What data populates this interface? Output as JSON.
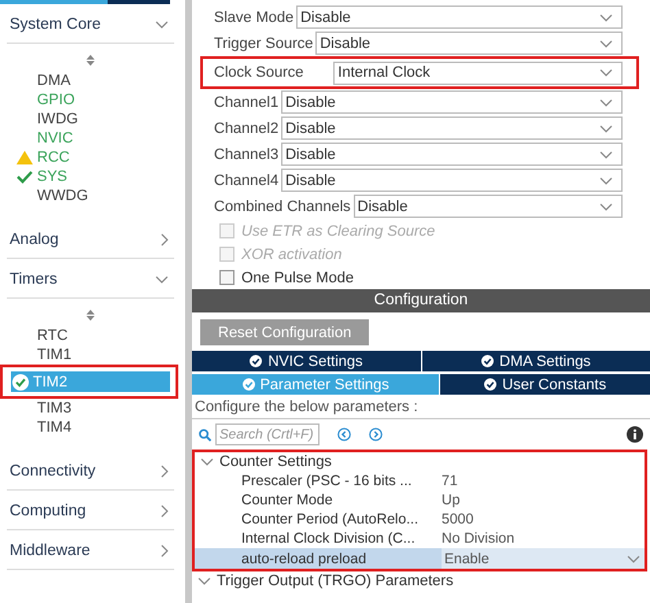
{
  "sidebar": {
    "sections": [
      {
        "title": "System Core",
        "expanded": true,
        "items": [
          {
            "label": "DMA",
            "active": false,
            "warning": false,
            "ok": false,
            "selected": false,
            "highlighted": false
          },
          {
            "label": "GPIO",
            "active": true,
            "warning": false,
            "ok": false,
            "selected": false,
            "highlighted": false
          },
          {
            "label": "IWDG",
            "active": false,
            "warning": false,
            "ok": false,
            "selected": false,
            "highlighted": false
          },
          {
            "label": "NVIC",
            "active": true,
            "warning": false,
            "ok": false,
            "selected": false,
            "highlighted": false
          },
          {
            "label": "RCC",
            "active": true,
            "warning": true,
            "ok": false,
            "selected": false,
            "highlighted": false
          },
          {
            "label": "SYS",
            "active": true,
            "warning": false,
            "ok": true,
            "selected": false,
            "highlighted": false
          },
          {
            "label": "WWDG",
            "active": false,
            "warning": false,
            "ok": false,
            "selected": false,
            "highlighted": false
          }
        ]
      },
      {
        "title": "Analog",
        "expanded": false
      },
      {
        "title": "Timers",
        "expanded": true,
        "items": [
          {
            "label": "RTC",
            "active": false,
            "warning": false,
            "ok": false,
            "selected": false,
            "highlighted": false
          },
          {
            "label": "TIM1",
            "active": false,
            "warning": false,
            "ok": false,
            "selected": false,
            "highlighted": false
          },
          {
            "label": "TIM2",
            "active": false,
            "warning": false,
            "ok": true,
            "selected": true,
            "highlighted": true
          },
          {
            "label": "TIM3",
            "active": false,
            "warning": false,
            "ok": false,
            "selected": false,
            "highlighted": false
          },
          {
            "label": "TIM4",
            "active": false,
            "warning": false,
            "ok": false,
            "selected": false,
            "highlighted": false
          }
        ]
      },
      {
        "title": "Connectivity",
        "expanded": false
      },
      {
        "title": "Computing",
        "expanded": false
      },
      {
        "title": "Middleware",
        "expanded": false
      }
    ]
  },
  "mode": {
    "fields": [
      {
        "label": "Slave Mode",
        "value": "Disable",
        "highlighted": false
      },
      {
        "label": "Trigger Source",
        "value": "Disable",
        "highlighted": false
      },
      {
        "label": "Clock Source",
        "value": "Internal Clock",
        "highlighted": true
      },
      {
        "label": "Channel1",
        "value": "Disable",
        "highlighted": false
      },
      {
        "label": "Channel2",
        "value": "Disable",
        "highlighted": false
      },
      {
        "label": "Channel3",
        "value": "Disable",
        "highlighted": false
      },
      {
        "label": "Channel4",
        "value": "Disable",
        "highlighted": false
      },
      {
        "label": "Combined Channels",
        "value": "Disable",
        "highlighted": false
      }
    ],
    "options": [
      {
        "label": "Use ETR as Clearing Source",
        "checked": false,
        "disabled": true
      },
      {
        "label": "XOR activation",
        "checked": false,
        "disabled": true
      },
      {
        "label": "One Pulse Mode",
        "checked": false,
        "disabled": false
      }
    ]
  },
  "configuration": {
    "title": "Configuration",
    "reset_button": "Reset Configuration",
    "tabs": [
      {
        "label": "NVIC Settings",
        "selected": false
      },
      {
        "label": "DMA Settings",
        "selected": false
      },
      {
        "label": "Parameter Settings",
        "selected": true
      },
      {
        "label": "User Constants",
        "selected": false
      }
    ],
    "hint": "Configure the below parameters :",
    "search": {
      "placeholder": "Search (Crtl+F)"
    },
    "groups": [
      {
        "title": "Counter Settings",
        "expanded": true,
        "highlighted": true,
        "params": [
          {
            "name": "Prescaler (PSC - 16 bits ...",
            "value": "71",
            "selected": false
          },
          {
            "name": "Counter Mode",
            "value": "Up",
            "selected": false
          },
          {
            "name": "Counter Period (AutoRelo...",
            "value": "5000",
            "selected": false
          },
          {
            "name": "Internal Clock Division (C...",
            "value": "No Division",
            "selected": false
          },
          {
            "name": "auto-reload preload",
            "value": "Enable",
            "selected": true
          }
        ]
      },
      {
        "title": "Trigger Output (TRGO) Parameters",
        "expanded": true,
        "highlighted": false
      }
    ]
  }
}
